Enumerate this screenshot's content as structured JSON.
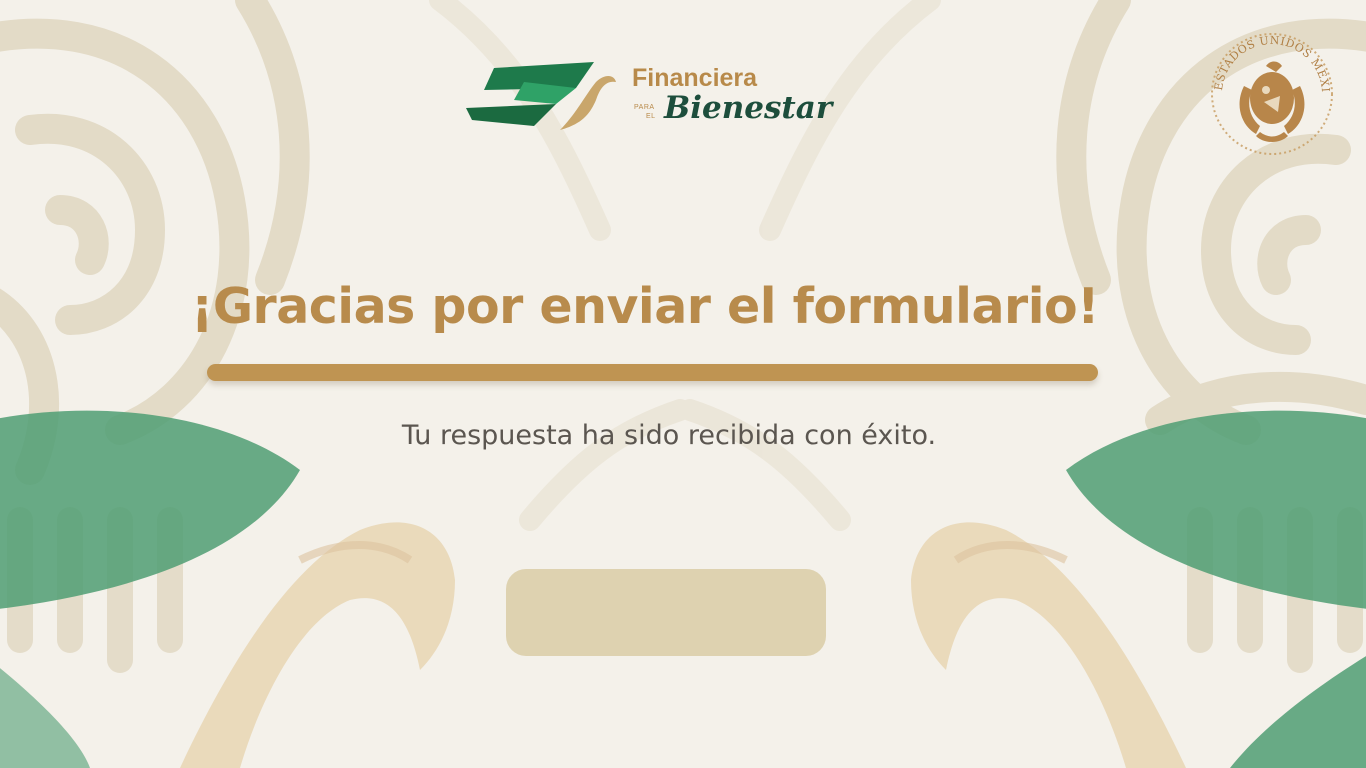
{
  "brand": {
    "name_top": "Financiera",
    "name_small_1": "PARA",
    "name_small_2": "EL",
    "name_bottom": "Bienestar",
    "primary_color": "#1d6b45",
    "accent_color": "#b88b4c"
  },
  "seal": {
    "text": "ESTADOS UNIDOS MEXICANOS",
    "icon": "coat-of-arms-seal"
  },
  "confirmation": {
    "title": "¡Gracias por enviar el formulario!",
    "message": "Tu respuesta ha sido recibida con éxito."
  },
  "button": {
    "label": "",
    "color": "#ded2b0"
  }
}
